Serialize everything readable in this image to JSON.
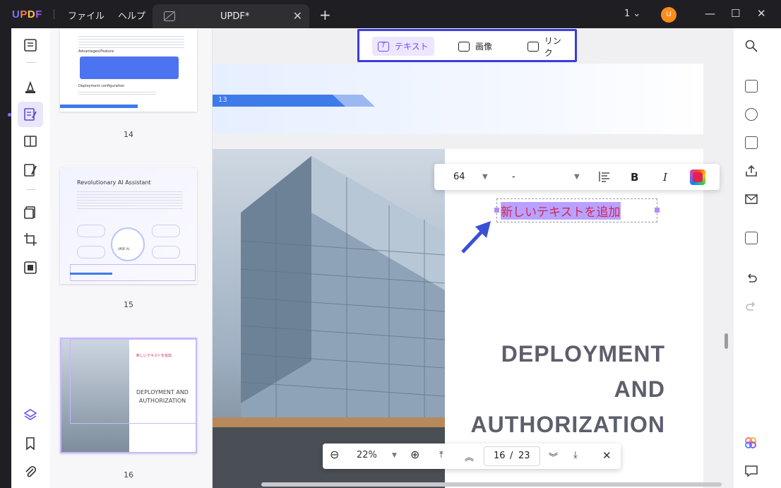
{
  "titlebar": {
    "logo": "UPDF",
    "menu": [
      "ファイル",
      "ヘルプ"
    ],
    "tab_title": "UPDF*",
    "page_indicator": "1",
    "avatar_initial": "U"
  },
  "edit_toolbar": {
    "text_label": "テキスト",
    "image_label": "画像",
    "link_label": "リンク"
  },
  "format_bar": {
    "font_size": "64",
    "font_name": "-",
    "bold_label": "B",
    "italic_label": "I",
    "text_color": "#e0234f"
  },
  "thumbnails": [
    {
      "page": "14",
      "heading": "Advantages/Feature",
      "subheading": "Deployment configuration"
    },
    {
      "page": "15",
      "title": "Revolutionary AI Assistant",
      "center_label": "UPDF AI"
    },
    {
      "page": "16",
      "title_line1": "DEPLOYMENT AND",
      "title_line2": "AUTHORIZATION",
      "note": "新しいテキストを追加"
    }
  ],
  "document": {
    "page13_number": "13",
    "inserted_text": "新しいテキストを追加",
    "title_line1": "DEPLOYMENT AND",
    "title_line2": "AUTHORIZATION"
  },
  "page_nav": {
    "zoom": "22%",
    "current_page": "16",
    "separator": "/",
    "total_pages": "23"
  },
  "colors": {
    "accent": "#6c4dff",
    "highlight_border": "#3a3ce0",
    "inserted_text_color": "#d2255a"
  }
}
